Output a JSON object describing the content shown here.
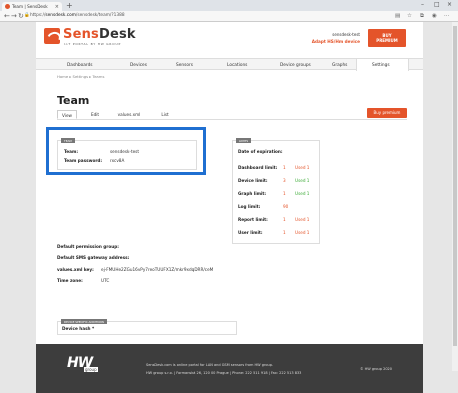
{
  "browser": {
    "tab_title": "Team | SensDesk",
    "new_tab": "+",
    "tab_close": "×",
    "url_prefix": "https://",
    "url_host": "sensdesk.com",
    "url_path": "/sensdesk/team/?1388",
    "win_min": "–",
    "win_max": "□",
    "win_close": "×"
  },
  "header": {
    "logo_sens": "Sens",
    "logo_desk": "Desk",
    "logo_sub": "IoT PORTAL BY HW GROUP",
    "user": "sensdesk-test",
    "user_sub": "Adapt HS/Hm device",
    "buy_line1": "BUY",
    "buy_line2": "PREMIUM"
  },
  "menu": [
    "Dashboards",
    "Devices",
    "Sensors",
    "Locations",
    "Device groups",
    "Graphs",
    "Settings"
  ],
  "breadcrumb": "Home ▸ Settings ▸ Teams",
  "title": "Team",
  "subtabs": [
    "View",
    "Edit",
    "values.xml",
    "List"
  ],
  "buy_premium": "Buy premium",
  "team_panel": {
    "header": "TEAM",
    "team_label": "Team:",
    "team_value": "sensdesk-test",
    "password_label": "Team password:",
    "password_value": "rxcv8A"
  },
  "limits_panel": {
    "header": "LIMITS",
    "expiration_label": "Date of expiration:",
    "rows": [
      {
        "label": "Dashboard limit:",
        "value": "1",
        "used": "Used 1",
        "status": "red"
      },
      {
        "label": "Device limit:",
        "value": "3",
        "used": "Used 1",
        "status": "green"
      },
      {
        "label": "Graph limit:",
        "value": "1",
        "used": "Used 1",
        "status": "green"
      },
      {
        "label": "Log limit:",
        "value": "90",
        "used": "",
        "status": "none"
      },
      {
        "label": "Report limit:",
        "value": "1",
        "used": "Used 1",
        "status": "red"
      },
      {
        "label": "User limit:",
        "value": "1",
        "used": "Used 1",
        "status": "red"
      }
    ]
  },
  "info": {
    "perm_label": "Default permission group:",
    "sms_label": "Default SMS gateway address:",
    "xml_label": "values.xml key:",
    "xml_value": "ej-FMUHe2ZGu16vPy7reoTUUFX1Z/mkr9xdqDRR/ceM",
    "tz_label": "Time zone:",
    "tz_value": "UTC"
  },
  "device_section": {
    "header": "DEVICE SPECIFIC ADDITIONS",
    "label": "Device hash *"
  },
  "footer": {
    "logo": "HW",
    "logo_sub": "group",
    "line1": "SensDesk.com is online portal for LAN and GSM sensors from HW group.",
    "line2": "HW group s.r.o. | Formanská 26, 120 00 Prague | Phone: 222 511 918 | Fax: 222 513 833",
    "copyright": "© HW group 2020"
  },
  "colors": {
    "accent": "#e4542a",
    "highlight": "#1f6fd1",
    "green": "#3aaa35"
  }
}
